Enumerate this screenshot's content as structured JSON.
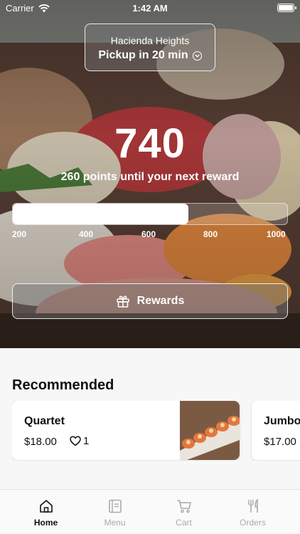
{
  "status_bar": {
    "carrier": "Carrier",
    "time": "1:42 AM"
  },
  "location": {
    "name": "Hacienda Heights",
    "pickup": "Pickup in 20 min"
  },
  "rewards": {
    "points": "740",
    "until_next": "260 points until your next reward",
    "progress_fraction": 0.64,
    "ticks": [
      "200",
      "400",
      "600",
      "800",
      "1000"
    ],
    "button_label": "Rewards"
  },
  "recommended": {
    "title": "Recommended",
    "items": [
      {
        "name": "Quartet",
        "price": "$18.00",
        "likes": "1"
      },
      {
        "name": "Jumbo",
        "price": "$17.00"
      }
    ]
  },
  "tabs": [
    {
      "label": "Home",
      "icon": "home-icon",
      "active": true
    },
    {
      "label": "Menu",
      "icon": "menu-icon",
      "active": false
    },
    {
      "label": "Cart",
      "icon": "cart-icon",
      "active": false
    },
    {
      "label": "Orders",
      "icon": "orders-icon",
      "active": false
    }
  ]
}
